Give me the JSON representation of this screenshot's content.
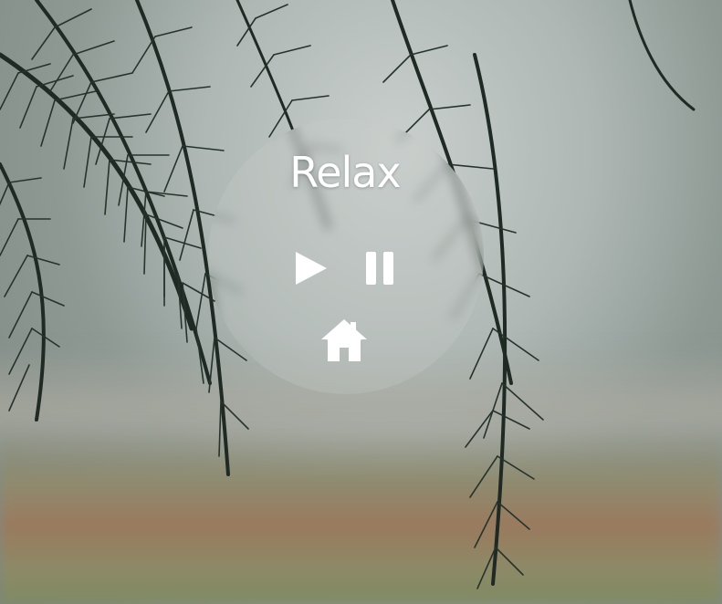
{
  "app": {
    "title": "Relax"
  },
  "controls": {
    "play_icon": "play-icon",
    "pause_icon": "pause-icon",
    "home_icon": "home-icon"
  },
  "colors": {
    "text": "#ffffff",
    "icon": "#ffffff"
  }
}
